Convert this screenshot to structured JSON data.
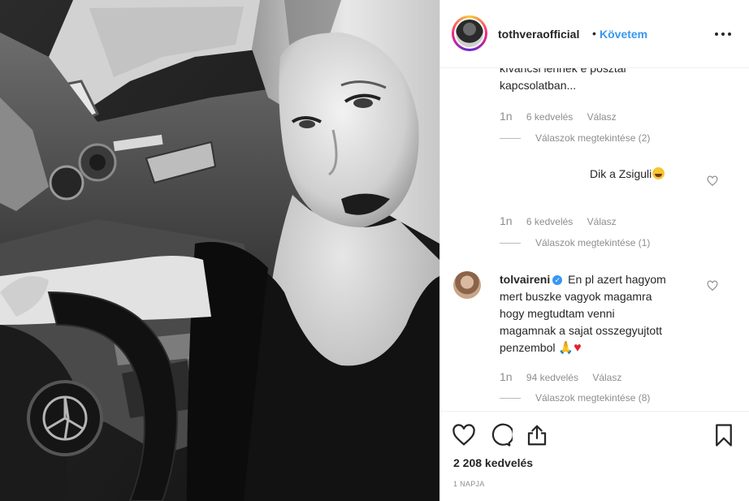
{
  "post": {
    "username": "tothveraofficial",
    "separator": "•",
    "follow_label": "Követem",
    "likes_label": "2 208 kedvelés",
    "time_label": "1 NAPJA"
  },
  "comments": [
    {
      "text_lines": [
        "kíváncsi lennék e posztal",
        "kapcsolatban..."
      ],
      "time": "1n",
      "likes": "6 kedvelés",
      "reply": "Válasz",
      "view_replies": "Válaszok megtekintése (2)"
    },
    {
      "text": "Dik a Zsiguli",
      "emoji": "laughing-emoji",
      "time": "1n",
      "likes": "6 kedvelés",
      "reply": "Válasz",
      "view_replies": "Válaszok megtekintése (1)"
    },
    {
      "username": "tolvaireni",
      "text_lines": [
        "En pl azert hagyom",
        "mert buszke vagyok magamra",
        "hogy megtudtam venni",
        "magamnak a sajat osszegyujtott",
        "penzembol"
      ],
      "emojis": [
        "folded-hands-emoji",
        "red-heart-emoji"
      ],
      "emoji_glyphs": [
        "🙏",
        "♥"
      ],
      "verified_glyph": "✓",
      "time": "1n",
      "likes": "94 kedvelés",
      "reply": "Válasz",
      "view_replies": "Válaszok megtekintése (8)"
    }
  ],
  "icons": {
    "more": "more-options-icon",
    "comment_like": "heart-outline-icon",
    "like": "heart-icon",
    "comment": "comment-bubble-icon",
    "share": "share-icon",
    "save": "bookmark-icon"
  },
  "colors": {
    "link_blue": "#3897f0",
    "text": "#262626",
    "muted": "#8e8e8e",
    "border": "#efefef"
  }
}
